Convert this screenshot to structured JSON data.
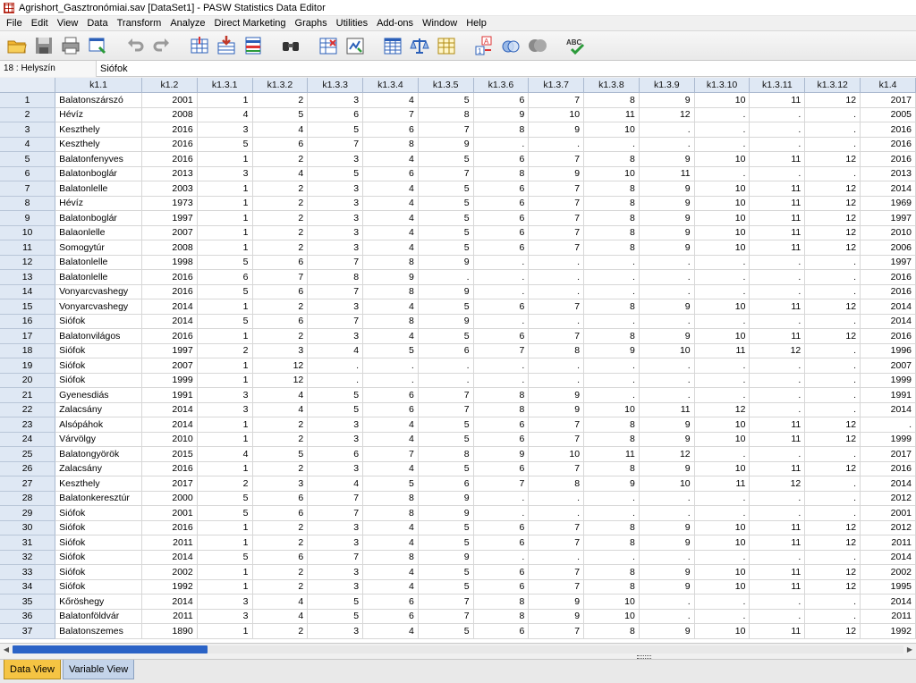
{
  "window": {
    "title": "Agrishort_Gasztronómiai.sav [DataSet1] - PASW Statistics Data Editor"
  },
  "menu": [
    "File",
    "Edit",
    "View",
    "Data",
    "Transform",
    "Analyze",
    "Direct Marketing",
    "Graphs",
    "Utilities",
    "Add-ons",
    "Window",
    "Help"
  ],
  "toolbar": {
    "icons": [
      "open-folder-icon",
      "save-icon",
      "print-icon",
      "dialog-recall-icon",
      "undo-icon",
      "redo-icon",
      "go-to-case-icon",
      "go-to-variable-icon",
      "variables-icon",
      "find-icon",
      "insert-cases-icon",
      "insert-variable-icon",
      "split-file-icon",
      "weight-cases-icon",
      "select-cases-icon",
      "value-labels-icon",
      "use-sets-icon",
      "show-all-variables-icon",
      "spell-check-icon"
    ]
  },
  "cell_editor": {
    "reference": "18 : Helyszín",
    "value": "Siófok"
  },
  "grid": {
    "columns": [
      "k1.1",
      "k1.2",
      "k1.3.1",
      "k1.3.2",
      "k1.3.3",
      "k1.3.4",
      "k1.3.5",
      "k1.3.6",
      "k1.3.7",
      "k1.3.8",
      "k1.3.9",
      "k1.3.10",
      "k1.3.11",
      "k1.3.12",
      "k1.4"
    ],
    "rows": [
      [
        "1",
        "Balatonszárszó",
        "2001",
        "1",
        "2",
        "3",
        "4",
        "5",
        "6",
        "7",
        "8",
        "9",
        "10",
        "11",
        "12",
        "2017"
      ],
      [
        "2",
        "Hévíz",
        "2008",
        "4",
        "5",
        "6",
        "7",
        "8",
        "9",
        "10",
        "11",
        "12",
        ".",
        ".",
        ".",
        "2005"
      ],
      [
        "3",
        "Keszthely",
        "2016",
        "3",
        "4",
        "5",
        "6",
        "7",
        "8",
        "9",
        "10",
        ".",
        ".",
        ".",
        ".",
        "2016"
      ],
      [
        "4",
        "Keszthely",
        "2016",
        "5",
        "6",
        "7",
        "8",
        "9",
        ".",
        ".",
        ".",
        ".",
        ".",
        ".",
        ".",
        "2016"
      ],
      [
        "5",
        "Balatonfenyves",
        "2016",
        "1",
        "2",
        "3",
        "4",
        "5",
        "6",
        "7",
        "8",
        "9",
        "10",
        "11",
        "12",
        "2016"
      ],
      [
        "6",
        "Balatonboglár",
        "2013",
        "3",
        "4",
        "5",
        "6",
        "7",
        "8",
        "9",
        "10",
        "11",
        ".",
        ".",
        ".",
        "2013"
      ],
      [
        "7",
        "Balatonlelle",
        "2003",
        "1",
        "2",
        "3",
        "4",
        "5",
        "6",
        "7",
        "8",
        "9",
        "10",
        "11",
        "12",
        "2014"
      ],
      [
        "8",
        "Hévíz",
        "1973",
        "1",
        "2",
        "3",
        "4",
        "5",
        "6",
        "7",
        "8",
        "9",
        "10",
        "11",
        "12",
        "1969"
      ],
      [
        "9",
        "Balatonboglár",
        "1997",
        "1",
        "2",
        "3",
        "4",
        "5",
        "6",
        "7",
        "8",
        "9",
        "10",
        "11",
        "12",
        "1997"
      ],
      [
        "10",
        "Balaonlelle",
        "2007",
        "1",
        "2",
        "3",
        "4",
        "5",
        "6",
        "7",
        "8",
        "9",
        "10",
        "11",
        "12",
        "2010"
      ],
      [
        "11",
        "Somogytúr",
        "2008",
        "1",
        "2",
        "3",
        "4",
        "5",
        "6",
        "7",
        "8",
        "9",
        "10",
        "11",
        "12",
        "2006"
      ],
      [
        "12",
        "Balatonlelle",
        "1998",
        "5",
        "6",
        "7",
        "8",
        "9",
        ".",
        ".",
        ".",
        ".",
        ".",
        ".",
        ".",
        "1997"
      ],
      [
        "13",
        "Balatonlelle",
        "2016",
        "6",
        "7",
        "8",
        "9",
        ".",
        ".",
        ".",
        ".",
        ".",
        ".",
        ".",
        ".",
        "2016"
      ],
      [
        "14",
        "Vonyarcvashegy",
        "2016",
        "5",
        "6",
        "7",
        "8",
        "9",
        ".",
        ".",
        ".",
        ".",
        ".",
        ".",
        ".",
        "2016"
      ],
      [
        "15",
        "Vonyarcvashegy",
        "2014",
        "1",
        "2",
        "3",
        "4",
        "5",
        "6",
        "7",
        "8",
        "9",
        "10",
        "11",
        "12",
        "2014"
      ],
      [
        "16",
        "Siófok",
        "2014",
        "5",
        "6",
        "7",
        "8",
        "9",
        ".",
        ".",
        ".",
        ".",
        ".",
        ".",
        ".",
        "2014"
      ],
      [
        "17",
        "Balatonvilágos",
        "2016",
        "1",
        "2",
        "3",
        "4",
        "5",
        "6",
        "7",
        "8",
        "9",
        "10",
        "11",
        "12",
        "2016"
      ],
      [
        "18",
        "Siófok",
        "1997",
        "2",
        "3",
        "4",
        "5",
        "6",
        "7",
        "8",
        "9",
        "10",
        "11",
        "12",
        ".",
        "1996"
      ],
      [
        "19",
        "Siófok",
        "2007",
        "1",
        "12",
        ".",
        ".",
        ".",
        ".",
        ".",
        ".",
        ".",
        ".",
        ".",
        ".",
        "2007"
      ],
      [
        "20",
        "Siófok",
        "1999",
        "1",
        "12",
        ".",
        ".",
        ".",
        ".",
        ".",
        ".",
        ".",
        ".",
        ".",
        ".",
        "1999"
      ],
      [
        "21",
        "Gyenesdiás",
        "1991",
        "3",
        "4",
        "5",
        "6",
        "7",
        "8",
        "9",
        ".",
        ".",
        ".",
        ".",
        ".",
        "1991"
      ],
      [
        "22",
        "Zalacsány",
        "2014",
        "3",
        "4",
        "5",
        "6",
        "7",
        "8",
        "9",
        "10",
        "11",
        "12",
        ".",
        ".",
        "2014"
      ],
      [
        "23",
        "Alsópáhok",
        "2014",
        "1",
        "2",
        "3",
        "4",
        "5",
        "6",
        "7",
        "8",
        "9",
        "10",
        "11",
        "12",
        "."
      ],
      [
        "24",
        "Várvölgy",
        "2010",
        "1",
        "2",
        "3",
        "4",
        "5",
        "6",
        "7",
        "8",
        "9",
        "10",
        "11",
        "12",
        "1999"
      ],
      [
        "25",
        "Balatongyörök",
        "2015",
        "4",
        "5",
        "6",
        "7",
        "8",
        "9",
        "10",
        "11",
        "12",
        ".",
        ".",
        ".",
        "2017"
      ],
      [
        "26",
        "Zalacsány",
        "2016",
        "1",
        "2",
        "3",
        "4",
        "5",
        "6",
        "7",
        "8",
        "9",
        "10",
        "11",
        "12",
        "2016"
      ],
      [
        "27",
        "Keszthely",
        "2017",
        "2",
        "3",
        "4",
        "5",
        "6",
        "7",
        "8",
        "9",
        "10",
        "11",
        "12",
        ".",
        "2014"
      ],
      [
        "28",
        "Balatonkeresztúr",
        "2000",
        "5",
        "6",
        "7",
        "8",
        "9",
        ".",
        ".",
        ".",
        ".",
        ".",
        ".",
        ".",
        "2012"
      ],
      [
        "29",
        "Siófok",
        "2001",
        "5",
        "6",
        "7",
        "8",
        "9",
        ".",
        ".",
        ".",
        ".",
        ".",
        ".",
        ".",
        "2001"
      ],
      [
        "30",
        "Siófok",
        "2016",
        "1",
        "2",
        "3",
        "4",
        "5",
        "6",
        "7",
        "8",
        "9",
        "10",
        "11",
        "12",
        "2012"
      ],
      [
        "31",
        "Siófok",
        "2011",
        "1",
        "2",
        "3",
        "4",
        "5",
        "6",
        "7",
        "8",
        "9",
        "10",
        "11",
        "12",
        "2011"
      ],
      [
        "32",
        "Siófok",
        "2014",
        "5",
        "6",
        "7",
        "8",
        "9",
        ".",
        ".",
        ".",
        ".",
        ".",
        ".",
        ".",
        "2014"
      ],
      [
        "33",
        "Siófok",
        "2002",
        "1",
        "2",
        "3",
        "4",
        "5",
        "6",
        "7",
        "8",
        "9",
        "10",
        "11",
        "12",
        "2002"
      ],
      [
        "34",
        "Siófok",
        "1992",
        "1",
        "2",
        "3",
        "4",
        "5",
        "6",
        "7",
        "8",
        "9",
        "10",
        "11",
        "12",
        "1995"
      ],
      [
        "35",
        "Kőröshegy",
        "2014",
        "3",
        "4",
        "5",
        "6",
        "7",
        "8",
        "9",
        "10",
        ".",
        ".",
        ".",
        ".",
        "2014"
      ],
      [
        "36",
        "Balatonföldvár",
        "2011",
        "3",
        "4",
        "5",
        "6",
        "7",
        "8",
        "9",
        "10",
        ".",
        ".",
        ".",
        ".",
        "2011"
      ],
      [
        "37",
        "Balatonszemes",
        "1890",
        "1",
        "2",
        "3",
        "4",
        "5",
        "6",
        "7",
        "8",
        "9",
        "10",
        "11",
        "12",
        "1992"
      ]
    ]
  },
  "tabs": {
    "data_view": "Data View",
    "variable_view": "Variable View"
  }
}
